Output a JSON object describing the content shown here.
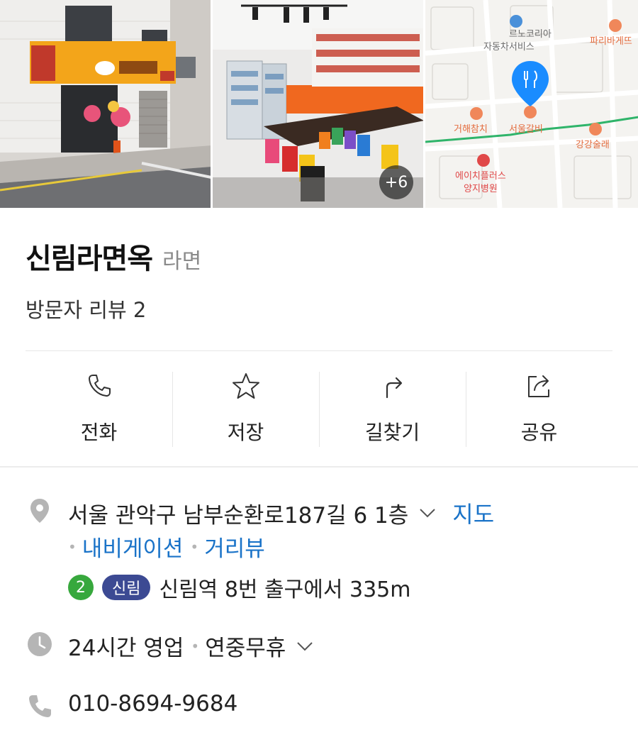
{
  "gallery": {
    "more_count": "+6",
    "map_labels": {
      "label1": "르노코리아",
      "label2": "자동차서비스",
      "label3": "파리바게뜨",
      "label4": "거해참치",
      "label5": "서울갈비",
      "label6": "강강술래",
      "label7": "에이치플러스",
      "label8": "양지병원"
    }
  },
  "place": {
    "name": "신림라면옥",
    "category": "라면",
    "reviews": "방문자 리뷰 2"
  },
  "actions": [
    {
      "label": "전화",
      "icon": "phone-icon"
    },
    {
      "label": "저장",
      "icon": "star-icon"
    },
    {
      "label": "길찾기",
      "icon": "directions-icon"
    },
    {
      "label": "공유",
      "icon": "share-icon"
    }
  ],
  "info": {
    "address": "서울 관악구 남부순환로187길 6 1층",
    "map_link": "지도",
    "navigation_link": "내비게이션",
    "street_view_link": "거리뷰",
    "subway_line": "2",
    "subway_station": "신림",
    "subway_text": "신림역 8번 출구에서 335m",
    "hours": "24시간 영업",
    "holiday": "연중무휴",
    "phone": "010-8694-9684"
  },
  "colors": {
    "link": "#1a73c8",
    "subway_line2": "#37a83d",
    "station_pill": "#3c4a93",
    "map_pin": "#1a8cff"
  }
}
